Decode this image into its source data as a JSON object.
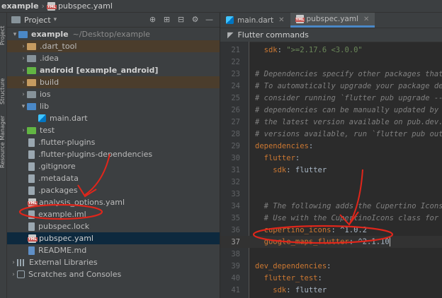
{
  "titlebar": {
    "project": "example",
    "file": "pubspec.yaml"
  },
  "side_tabs": [
    "Project",
    "Structure",
    "Resource Manager"
  ],
  "project_panel": {
    "title": "Project",
    "tree": [
      {
        "label": "example",
        "suffix": "~/Desktop/example"
      },
      {
        "label": ".dart_tool"
      },
      {
        "label": ".idea"
      },
      {
        "label": "android [example_android]"
      },
      {
        "label": "build"
      },
      {
        "label": "ios"
      },
      {
        "label": "lib"
      },
      {
        "label": "main.dart"
      },
      {
        "label": "test"
      },
      {
        "label": ".flutter-plugins"
      },
      {
        "label": ".flutter-plugins-dependencies"
      },
      {
        "label": ".gitignore"
      },
      {
        "label": ".metadata"
      },
      {
        "label": ".packages"
      },
      {
        "label": "analysis_options.yaml"
      },
      {
        "label": "example.iml"
      },
      {
        "label": "pubspec.lock"
      },
      {
        "label": "pubspec.yaml"
      },
      {
        "label": "README.md"
      },
      {
        "label": "External Libraries"
      },
      {
        "label": "Scratches and Consoles"
      }
    ]
  },
  "editor": {
    "tabs": [
      {
        "label": "main.dart"
      },
      {
        "label": "pubspec.yaml"
      }
    ],
    "notice": "Flutter commands",
    "lines": [
      {
        "n": "21",
        "a": "  sdk: ",
        "b": "\">=2.17.6 <3.0.0\""
      },
      {
        "n": "22",
        "a": "",
        "b": ""
      },
      {
        "n": "23",
        "a": "# Dependencies specify other packages that y",
        "b": ""
      },
      {
        "n": "24",
        "a": "# To automatically upgrade your package depen",
        "b": ""
      },
      {
        "n": "25",
        "a": "# consider running `flutter pub upgrade --maj",
        "b": ""
      },
      {
        "n": "26",
        "a": "# dependencies can be manually updated by cha",
        "b": ""
      },
      {
        "n": "27",
        "a": "# the latest version available on pub.dev. To",
        "b": ""
      },
      {
        "n": "28",
        "a": "# versions available, run `flutter pub outdat",
        "b": ""
      },
      {
        "n": "29",
        "a": "dependencies",
        "b": ":"
      },
      {
        "n": "30",
        "a": "  flutter",
        "b": ":"
      },
      {
        "n": "31",
        "a": "    sdk",
        "b": ": flutter"
      },
      {
        "n": "32",
        "a": "",
        "b": ""
      },
      {
        "n": "33",
        "a": "",
        "b": ""
      },
      {
        "n": "34",
        "a": "  # The following adds the Cupertino Icons fo",
        "b": ""
      },
      {
        "n": "35",
        "a": "  # Use with the CupertinoIcons class for iOS",
        "b": ""
      },
      {
        "n": "36",
        "a": "  cupertino_icons",
        "b": ": ^1.0.2"
      },
      {
        "n": "37",
        "a": "  google_maps_flutter",
        "b": ": ^2.1.10"
      },
      {
        "n": "38",
        "a": "",
        "b": ""
      },
      {
        "n": "39",
        "a": "dev_dependencies",
        "b": ":"
      },
      {
        "n": "40",
        "a": "  flutter_test",
        "b": ":"
      },
      {
        "n": "41",
        "a": "    sdk",
        "b": ": flutter"
      }
    ]
  },
  "colors": {
    "selection": "#0d293e",
    "annotation": "#e0261b",
    "keyword": "#cc7832",
    "string": "#6a8759",
    "comment": "#808080"
  }
}
